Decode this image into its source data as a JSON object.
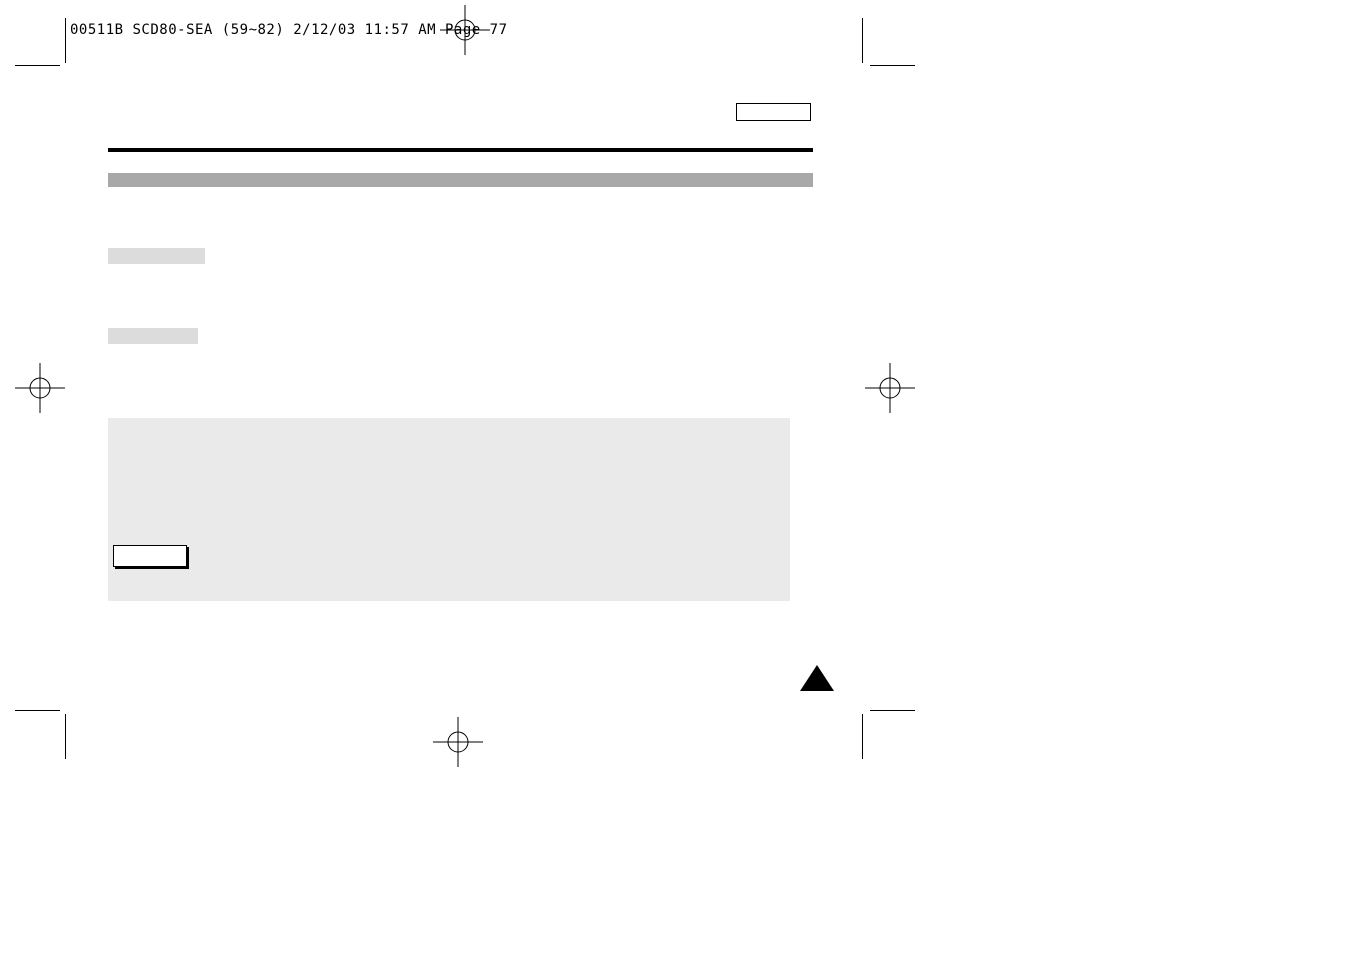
{
  "header": "00511B SCD80-SEA (59~82)  2/12/03 11:57 AM  Page 77"
}
